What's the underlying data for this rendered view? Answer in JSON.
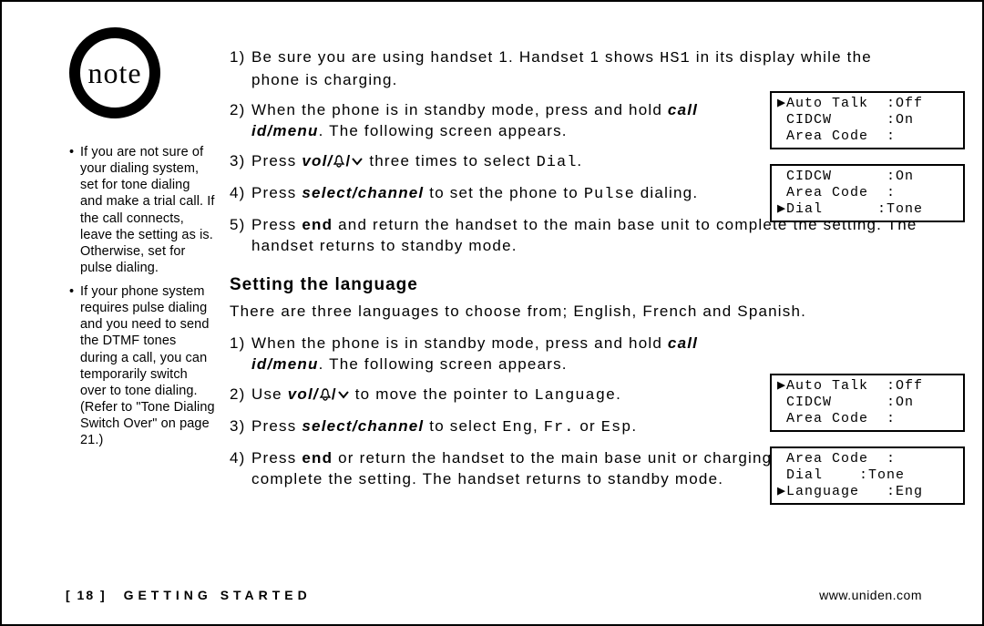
{
  "note_label": "note",
  "sidebar": {
    "items": [
      "If you are not sure of your dialing system, set for tone dialing and make a trial call. If the call connects, leave the setting as is. Otherwise, set for pulse dialing.",
      "If your phone system requires pulse dialing and you need to send the DTMF tones during a call, you can temporarily switch over to tone dialing. (Refer to \"Tone Dialing Switch Over\" on page 21.)"
    ]
  },
  "steps_top": [
    {
      "n": "1)",
      "pre": "Be sure you are using handset 1. Handset 1 shows ",
      "ocr1": "HS1",
      "post": " in its display while the phone is charging."
    },
    {
      "n": "2)",
      "pre": "When the phone is in standby mode, press and hold ",
      "bi": "call id/menu",
      "post": ". The following screen appears."
    },
    {
      "n": "3)",
      "pre": "Press ",
      "bi": "vol/",
      "mid": " three times to select ",
      "ocr1": "Dial",
      "post": "."
    },
    {
      "n": "4)",
      "pre": "Press ",
      "bi": "select/channel",
      "mid": " to set the phone to ",
      "ocr1": "Pulse",
      "post": " dialing."
    },
    {
      "n": "5)",
      "pre": "Press ",
      "bi2": "end",
      "post": " and return the handset to the main base unit to complete the setting. The handset returns to standby mode."
    }
  ],
  "section_heading": "Setting the language",
  "section_intro": "There are three languages to choose from; English, French and Spanish.",
  "steps_lang": [
    {
      "n": "1)",
      "pre": "When the phone is in standby mode, press and hold ",
      "bi": "call id/menu",
      "post": ". The following screen appears."
    },
    {
      "n": "2)",
      "pre": "Use ",
      "bi": "vol/",
      "mid": " to move the pointer to ",
      "ocr1": "Language",
      "post": "."
    },
    {
      "n": "3)",
      "pre": "Press ",
      "bi": "select/channel",
      "mid": " to select ",
      "ocr1": "Eng",
      "sep1": ", ",
      "ocr2": "Fr.",
      "sep2": " or ",
      "ocr3": "Esp",
      "post": "."
    },
    {
      "n": "4)",
      "pre": "Press ",
      "bi2": "end",
      "post": " or return the handset to the main base unit or charging cradle to complete the setting. The handset returns to standby mode."
    }
  ],
  "lcd": {
    "a": "▶Auto Talk  :Off\n CIDCW      :On\n Area Code  :",
    "b": " CIDCW      :On\n Area Code  :\n▶Dial      :Tone",
    "c": "▶Auto Talk  :Off\n CIDCW      :On\n Area Code  :",
    "d": " Area Code  :\n Dial    :Tone\n▶Language   :Eng"
  },
  "footer": {
    "page": "[ 18 ]",
    "section": "GETTING STARTED",
    "url": "www.uniden.com"
  }
}
